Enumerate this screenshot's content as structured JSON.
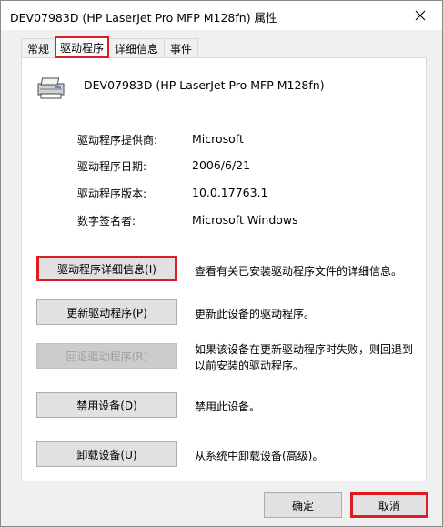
{
  "window": {
    "title": "DEV07983D (HP LaserJet Pro MFP M128fn) 属性"
  },
  "tabs": [
    {
      "label": "常规"
    },
    {
      "label": "驱动程序"
    },
    {
      "label": "详细信息"
    },
    {
      "label": "事件"
    }
  ],
  "device": {
    "name": "DEV07983D (HP LaserJet Pro MFP M128fn)",
    "icon": "printer-icon"
  },
  "info": [
    {
      "label": "驱动程序提供商:",
      "value": "Microsoft"
    },
    {
      "label": "驱动程序日期:",
      "value": "2006/6/21"
    },
    {
      "label": "驱动程序版本:",
      "value": "10.0.17763.1"
    },
    {
      "label": "数字签名者:",
      "value": "Microsoft Windows"
    }
  ],
  "actions": [
    {
      "label": "驱动程序详细信息(I)",
      "desc": "查看有关已安装驱动程序文件的详细信息。"
    },
    {
      "label": "更新驱动程序(P)",
      "desc": "更新此设备的驱动程序。"
    },
    {
      "label": "回退驱动程序(R)",
      "desc": "如果该设备在更新驱动程序时失败，则回退到以前安装的驱动程序。"
    },
    {
      "label": "禁用设备(D)",
      "desc": "禁用此设备。"
    },
    {
      "label": "卸载设备(U)",
      "desc": "从系统中卸载设备(高级)。"
    }
  ],
  "footer": {
    "ok_label": "确定",
    "cancel_label": "取消"
  },
  "colors": {
    "highlight": "#e01b24"
  }
}
